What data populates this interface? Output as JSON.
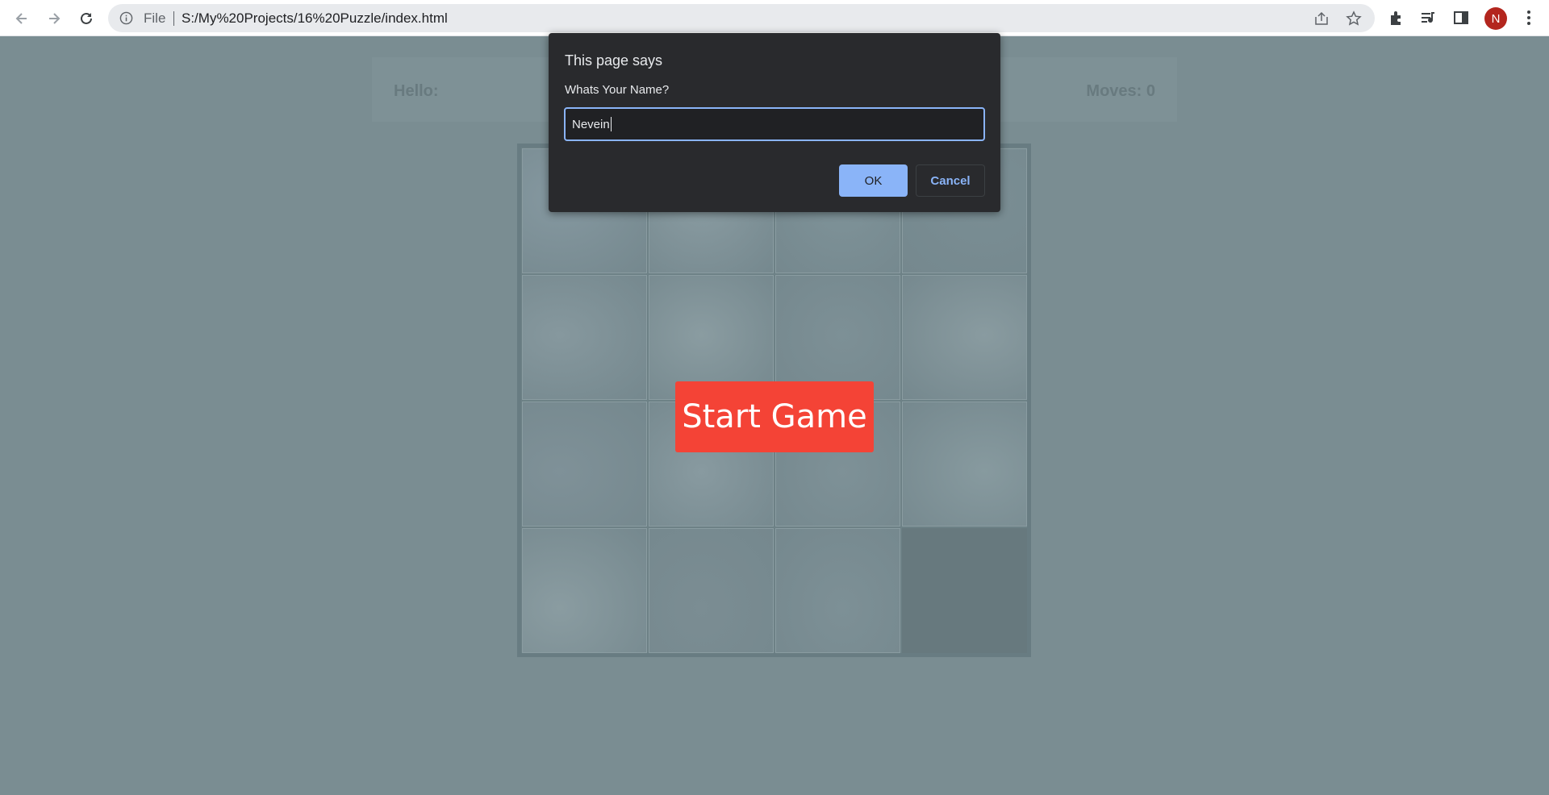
{
  "browser": {
    "omnibox_prefix": "File",
    "url": "S:/My%20Projects/16%20Puzzle/index.html",
    "profile_initial": "N",
    "icons": [
      "back-arrow-icon",
      "forward-arrow-icon",
      "reload-icon",
      "info-icon",
      "share-icon",
      "bookmark-star-icon",
      "extensions-icon",
      "media-queue-icon",
      "side-panel-icon",
      "more-vert-icon"
    ]
  },
  "page": {
    "hello_label": "Hello:",
    "moves_label": "Moves: 0",
    "start_button_label": "Start Game",
    "board": {
      "rows": 4,
      "cols": 4,
      "empty_tile": [
        3,
        3
      ]
    }
  },
  "dialog": {
    "title": "This page says",
    "message": "Whats Your Name?",
    "input_value": "Nevein",
    "ok_label": "OK",
    "cancel_label": "Cancel"
  },
  "colors": {
    "overlay_bg": "#7a8d92",
    "start_button": "#f44336",
    "dialog_bg": "#292a2d",
    "accent": "#8ab4f8"
  }
}
